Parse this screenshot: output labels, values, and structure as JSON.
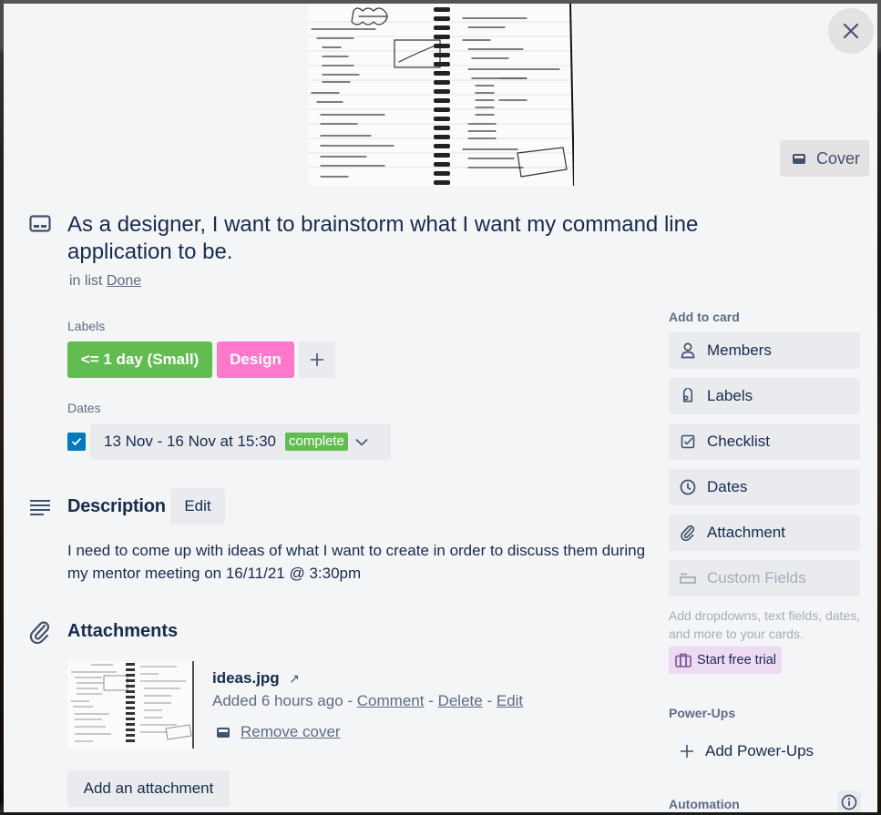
{
  "modal": {
    "close_label": "Close",
    "cover_button": "Cover",
    "title": "As a designer, I want to brainstorm what I want my command line application to be.",
    "in_list_prefix": "in list",
    "list_name": "Done"
  },
  "labels": {
    "heading": "Labels",
    "items": [
      {
        "text": "<= 1 day (Small)",
        "color": "#61bd4f"
      },
      {
        "text": "Design",
        "color": "#ff78cb"
      }
    ],
    "add_label": "+"
  },
  "dates": {
    "heading": "Dates",
    "checked": true,
    "range": "13 Nov - 16 Nov at 15:30",
    "status": "complete",
    "status_color": "#61bd4f"
  },
  "description": {
    "heading": "Description",
    "edit_label": "Edit",
    "text": "I need to come up with ideas of what I want to create in order to discuss them during my mentor meeting on 16/11/21 @ 3:30pm"
  },
  "attachments": {
    "heading": "Attachments",
    "items": [
      {
        "name": "ideas.jpg",
        "open_icon": "↗",
        "added": "Added 6 hours ago",
        "separator": " - ",
        "actions": [
          "Comment",
          "Delete",
          "Edit"
        ],
        "remove_cover": "Remove cover"
      }
    ],
    "add_label": "Add an attachment"
  },
  "sidebar": {
    "add_to_card_heading": "Add to card",
    "buttons": [
      {
        "label": "Members",
        "icon": "person-icon"
      },
      {
        "label": "Labels",
        "icon": "tag-icon"
      },
      {
        "label": "Checklist",
        "icon": "checklist-icon"
      },
      {
        "label": "Dates",
        "icon": "clock-icon"
      },
      {
        "label": "Attachment",
        "icon": "paperclip-icon"
      },
      {
        "label": "Custom Fields",
        "icon": "custom-fields-icon",
        "disabled": true
      }
    ],
    "custom_fields_help": "Add dropdowns, text fields, dates, and more to your cards.",
    "trial_label": "Start free trial",
    "powerups_heading": "Power-Ups",
    "add_powerups": "Add Power-Ups",
    "automation_heading": "Automation"
  },
  "colors": {
    "accent": "#0079bf",
    "modal_bg": "#f4f5f7",
    "button_bg": "#e9ebee",
    "text_primary": "#172b4d",
    "text_secondary": "#5e6c84",
    "trial_bg": "#eddbf4"
  }
}
